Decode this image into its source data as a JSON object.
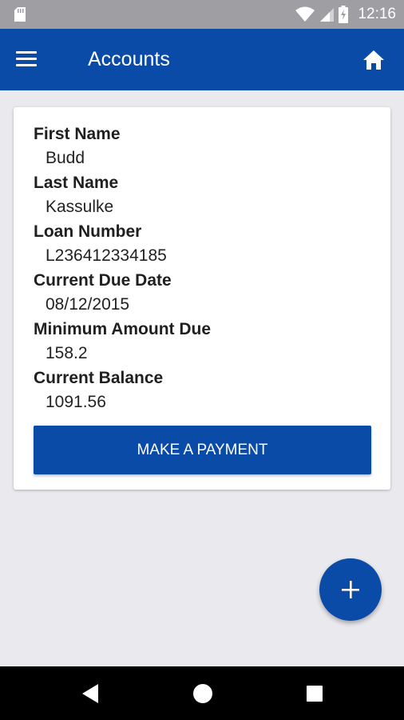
{
  "status_bar": {
    "time": "12:16",
    "icons": [
      "sim-card-icon",
      "wifi-icon",
      "signal-icon",
      "battery-charging-icon"
    ]
  },
  "app_bar": {
    "title": "Accounts",
    "menu_icon": "hamburger-menu-icon",
    "home_icon": "home-icon"
  },
  "account": {
    "fields": [
      {
        "label": "First Name",
        "value": "Budd"
      },
      {
        "label": "Last Name",
        "value": "Kassulke"
      },
      {
        "label": "Loan Number",
        "value": "L236412334185"
      },
      {
        "label": "Current Due Date",
        "value": "08/12/2015"
      },
      {
        "label": "Minimum Amount Due",
        "value": "158.2"
      },
      {
        "label": "Current Balance",
        "value": "1091.56"
      }
    ],
    "payment_button_label": "MAKE A PAYMENT"
  },
  "fab": {
    "icon": "plus-icon"
  },
  "nav_bar": {
    "icons": [
      "back-icon",
      "home-circle-icon",
      "recents-icon"
    ]
  },
  "colors": {
    "primary": "#0a4ba8",
    "background": "#e9e9ee",
    "status_bar": "#9e9ea3",
    "nav_bar": "#000000"
  }
}
